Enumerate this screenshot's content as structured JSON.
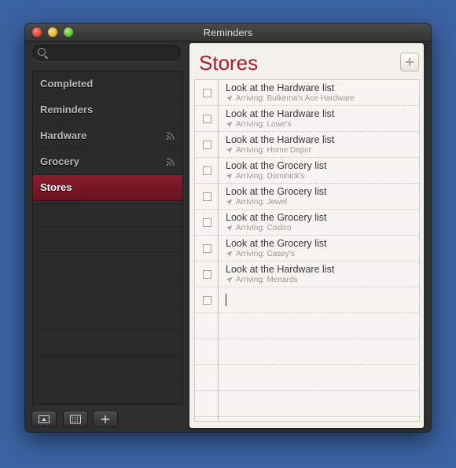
{
  "window": {
    "title": "Reminders"
  },
  "search": {
    "placeholder": "",
    "value": ""
  },
  "sidebar": {
    "items": [
      {
        "label": "Completed",
        "shared": false,
        "selected": false
      },
      {
        "label": "Reminders",
        "shared": false,
        "selected": false
      },
      {
        "label": "Hardware",
        "shared": true,
        "selected": false
      },
      {
        "label": "Grocery",
        "shared": true,
        "selected": false
      },
      {
        "label": "Stores",
        "shared": false,
        "selected": true
      }
    ]
  },
  "list": {
    "title": "Stores",
    "items": [
      {
        "title": "Look at the Hardware list",
        "subtitle": "Arriving: Buikema's Ace Hardware"
      },
      {
        "title": "Look at the Hardware list",
        "subtitle": "Arriving: Lowe's"
      },
      {
        "title": "Look at the Hardware list",
        "subtitle": "Arriving: Home Depot"
      },
      {
        "title": "Look at the Grocery list",
        "subtitle": "Arriving: Dominick's"
      },
      {
        "title": "Look at the Grocery list",
        "subtitle": "Arriving: Jewel"
      },
      {
        "title": "Look at the Grocery list",
        "subtitle": "Arriving: Costco"
      },
      {
        "title": "Look at the Grocery list",
        "subtitle": "Arriving: Casey's"
      },
      {
        "title": "Look at the Hardware list",
        "subtitle": "Arriving: Menards"
      }
    ]
  },
  "colors": {
    "accent": "#a8202a",
    "selected_row": "#7a1726",
    "desktop": "#3b62a2"
  }
}
